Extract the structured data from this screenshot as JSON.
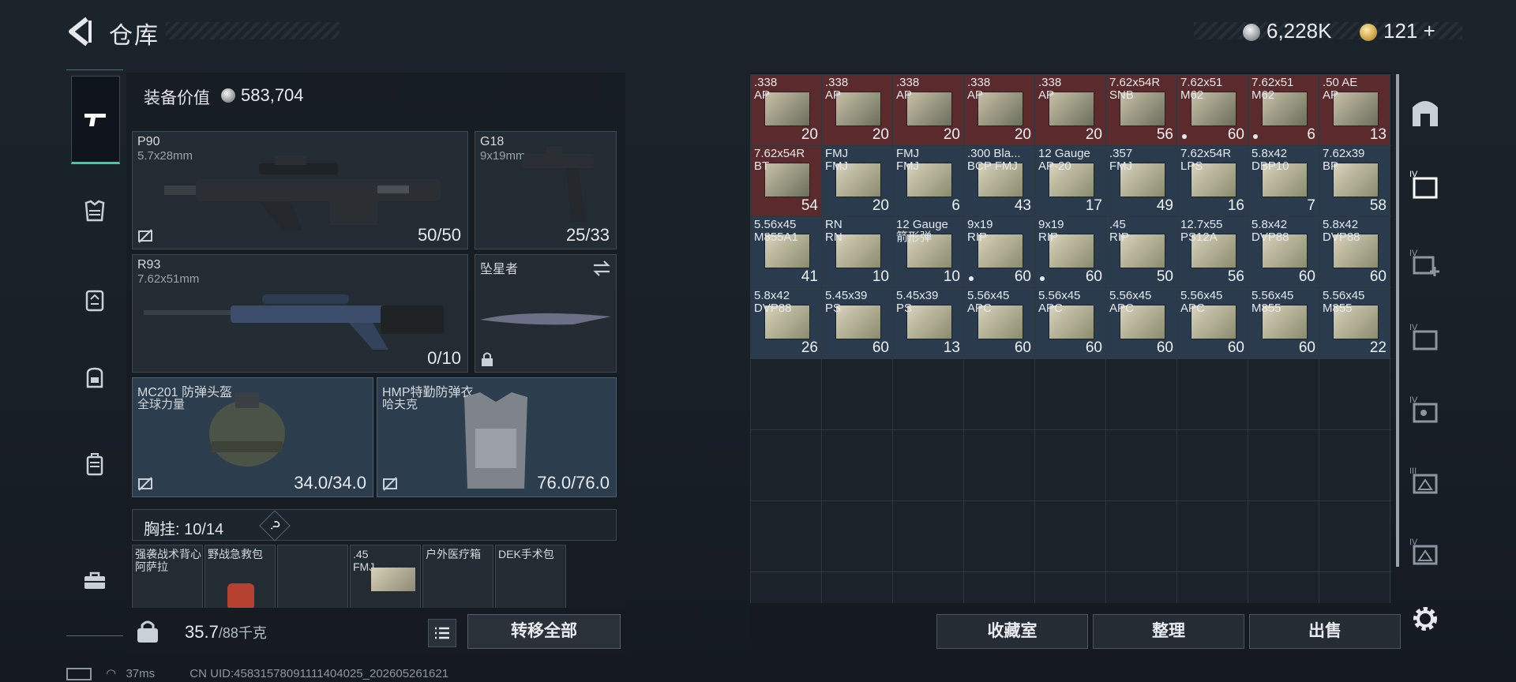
{
  "header": {
    "title": "仓库",
    "silver": "6,228K",
    "gold": "121",
    "gold_plus": "+"
  },
  "left_rail": [
    "weapon-icon",
    "armor-icon",
    "rig-icon",
    "backpack-icon",
    "case-icon",
    "toolbox-icon"
  ],
  "equipment": {
    "value_label": "装备价值",
    "value": "583,704",
    "primary": {
      "name": "P90",
      "caliber": "5.7x28mm",
      "ammo": "50/50"
    },
    "secondary": {
      "name": "G18",
      "caliber": "9x19mm",
      "ammo": "25/33"
    },
    "primary2": {
      "name": "R93",
      "caliber": "7.62x51mm",
      "ammo": "0/10"
    },
    "melee": {
      "name": "坠星者"
    },
    "helmet": {
      "name": "MC201 防弹头盔",
      "sub": "全球力量",
      "dur": "34.0/34.0"
    },
    "armor": {
      "name": "HMP特勤防弹衣",
      "sub": "哈夫克",
      "dur": "76.0/76.0"
    },
    "chest_label": "胸挂:",
    "chest_cap": "10/14",
    "chest_help": "?",
    "pouches": [
      {
        "name": "强袭战术背心",
        "sub": "阿萨拉"
      },
      {
        "name": "野战急救包",
        "sub": ""
      },
      {
        "name": "",
        "sub": ""
      },
      {
        "name": ".45",
        "sub": "FMJ"
      },
      {
        "name": "户外医疗箱",
        "sub": ""
      },
      {
        "name": "DEK手术包",
        "sub": ""
      }
    ]
  },
  "bag": {
    "weight": "35.7",
    "weight_max": "/88千克",
    "transfer": "转移全部"
  },
  "storage": {
    "items": [
      {
        "cal": ".338\nAP",
        "count": "20",
        "color": "red",
        "dot": false
      },
      {
        "cal": ".338\nAP",
        "count": "20",
        "color": "red",
        "dot": false
      },
      {
        "cal": ".338\nAP",
        "count": "20",
        "color": "red",
        "dot": false
      },
      {
        "cal": ".338\nAP",
        "count": "20",
        "color": "red",
        "dot": false
      },
      {
        "cal": ".338\nAP",
        "count": "20",
        "color": "red",
        "dot": false
      },
      {
        "cal": "7.62x54R\nSNB",
        "count": "56",
        "color": "red",
        "dot": false
      },
      {
        "cal": "7.62x51\nM62",
        "count": "60",
        "color": "red",
        "dot": true
      },
      {
        "cal": "7.62x51\nM62",
        "count": "6",
        "color": "red",
        "dot": true
      },
      {
        "cal": ".50 AE\nAP",
        "count": "13",
        "color": "red",
        "dot": false
      },
      {
        "cal": "7.62x54R\nBT",
        "count": "54",
        "color": "red",
        "dot": false
      },
      {
        "cal": "FMJ\nFMJ",
        "count": "20",
        "color": "blu",
        "dot": false
      },
      {
        "cal": "FMJ\nFMJ",
        "count": "6",
        "color": "blu",
        "dot": false
      },
      {
        "cal": ".300 Bla...\nBCP FMJ",
        "count": "43",
        "color": "blu",
        "dot": false
      },
      {
        "cal": "12 Gauge\nAP-20",
        "count": "17",
        "color": "blu",
        "dot": false
      },
      {
        "cal": ".357\nFMJ",
        "count": "49",
        "color": "blu",
        "dot": false
      },
      {
        "cal": "7.62x54R\nLPS",
        "count": "16",
        "color": "blu",
        "dot": false
      },
      {
        "cal": "5.8x42\nDBP10",
        "count": "7",
        "color": "blu",
        "dot": false
      },
      {
        "cal": "7.62x39\nBP",
        "count": "58",
        "color": "blu",
        "dot": false
      },
      {
        "cal": "5.56x45\nM855A1",
        "count": "41",
        "color": "blu",
        "dot": false
      },
      {
        "cal": "RN\nRN",
        "count": "10",
        "color": "blu",
        "dot": false
      },
      {
        "cal": "12 Gauge\n箭形弹",
        "count": "10",
        "color": "blu",
        "dot": false
      },
      {
        "cal": "9x19\nRIP",
        "count": "60",
        "color": "blu",
        "dot": true
      },
      {
        "cal": "9x19\nRIP",
        "count": "60",
        "color": "blu",
        "dot": true
      },
      {
        "cal": ".45\nRIP",
        "count": "50",
        "color": "blu",
        "dot": false
      },
      {
        "cal": "12.7x55\nPS12A",
        "count": "56",
        "color": "blu",
        "dot": false
      },
      {
        "cal": "5.8x42\nDVP88",
        "count": "60",
        "color": "blu",
        "dot": false
      },
      {
        "cal": "5.8x42\nDVP88",
        "count": "60",
        "color": "blu",
        "dot": false
      },
      {
        "cal": "5.8x42\nDVP88",
        "count": "26",
        "color": "blu",
        "dot": false
      },
      {
        "cal": "5.45x39\nPS",
        "count": "60",
        "color": "blu",
        "dot": false
      },
      {
        "cal": "5.45x39\nPS",
        "count": "13",
        "color": "blu",
        "dot": false
      },
      {
        "cal": "5.56x45\nAPC",
        "count": "60",
        "color": "blu",
        "dot": false
      },
      {
        "cal": "5.56x45\nAPC",
        "count": "60",
        "color": "blu",
        "dot": false
      },
      {
        "cal": "5.56x45\nAPC",
        "count": "60",
        "color": "blu",
        "dot": false
      },
      {
        "cal": "5.56x45\nAPC",
        "count": "60",
        "color": "blu",
        "dot": false
      },
      {
        "cal": "5.56x45\nM855",
        "count": "60",
        "color": "blu",
        "dot": false
      },
      {
        "cal": "5.56x45\nM855",
        "count": "22",
        "color": "blu",
        "dot": false
      }
    ],
    "buttons": {
      "collection": "收藏室",
      "sort": "整理",
      "sell": "出售"
    }
  },
  "right_rail": [
    "safebox-icon",
    "iv-storage-icon",
    "iv-add-icon",
    "iv-case-icon",
    "iv-key-icon",
    "iii-case-icon",
    "iv-case2-icon",
    "settings-icon"
  ],
  "status": {
    "ping": "37ms",
    "uid": "CN UID:4583157809111140402​5_202605261621"
  }
}
